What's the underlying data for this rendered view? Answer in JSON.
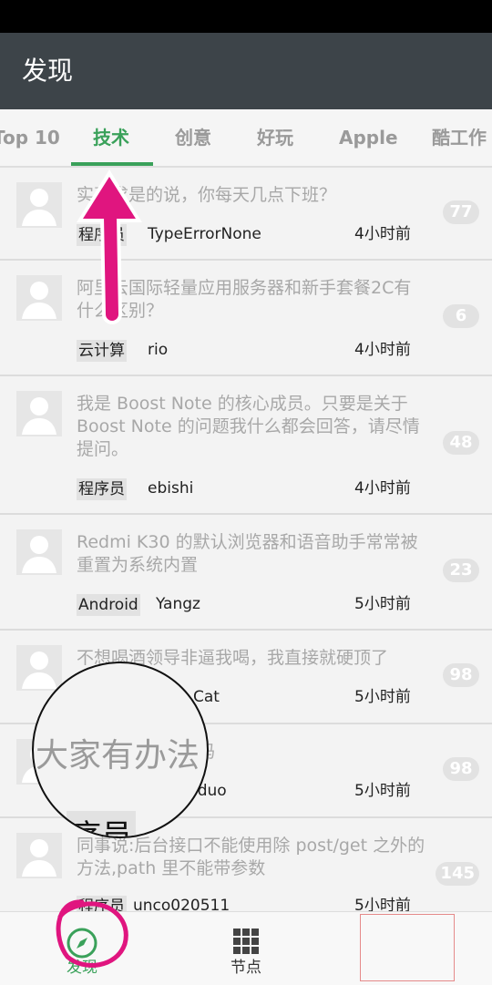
{
  "header": {
    "title": "发现"
  },
  "tabs": [
    {
      "label": "Top 10"
    },
    {
      "label": "技术"
    },
    {
      "label": "创意"
    },
    {
      "label": "好玩"
    },
    {
      "label": "Apple"
    },
    {
      "label": "酷工作"
    }
  ],
  "topics": [
    {
      "title": "实事求是的说，你每天几点下班？",
      "node": "程序员",
      "author": "TypeErrorNone",
      "time": "4小时前",
      "replies": "77"
    },
    {
      "title": "阿里云国际轻量应用服务器和新手套餐2C有什么区别？",
      "node": "云计算",
      "author": "rio",
      "time": "4小时前",
      "replies": "6"
    },
    {
      "title": "我是 Boost Note 的核心成员。只要是关于 Boost Note 的问题我什么都会回答，请尽情提问。",
      "node": "程序员",
      "author": "ebishi",
      "time": "4小时前",
      "replies": "48"
    },
    {
      "title": "Redmi K30 的默认浏览器和语音助手常常被重置为系统内置",
      "node": "Android",
      "author": "Yangz",
      "time": "5小时前",
      "replies": "23"
    },
    {
      "title": "不想喝酒领导非逼我喝，我直接就硬顶了",
      "node": "",
      "author": "Cat",
      "time": "5小时前",
      "replies": "98"
    },
    {
      "title": "大家有办法焦虑吗",
      "node": "",
      "author": "iduo",
      "time": "5小时前",
      "replies": "98"
    },
    {
      "title": "同事说:后台接口不能使用除 post/get 之外的方法,path 里不能带参数",
      "node": "程序员",
      "author": "unco020511",
      "time": "5小时前",
      "replies": "145"
    }
  ],
  "bottom_nav": [
    {
      "label": "发现",
      "icon": "compass-icon"
    },
    {
      "label": "节点",
      "icon": "grid-icon"
    }
  ],
  "magnifier": {
    "text_1": "大家有办法",
    "text_2": "序员"
  },
  "colors": {
    "accent": "#3aa15a",
    "header": "#3d4449",
    "annotation": "#e0157f"
  }
}
